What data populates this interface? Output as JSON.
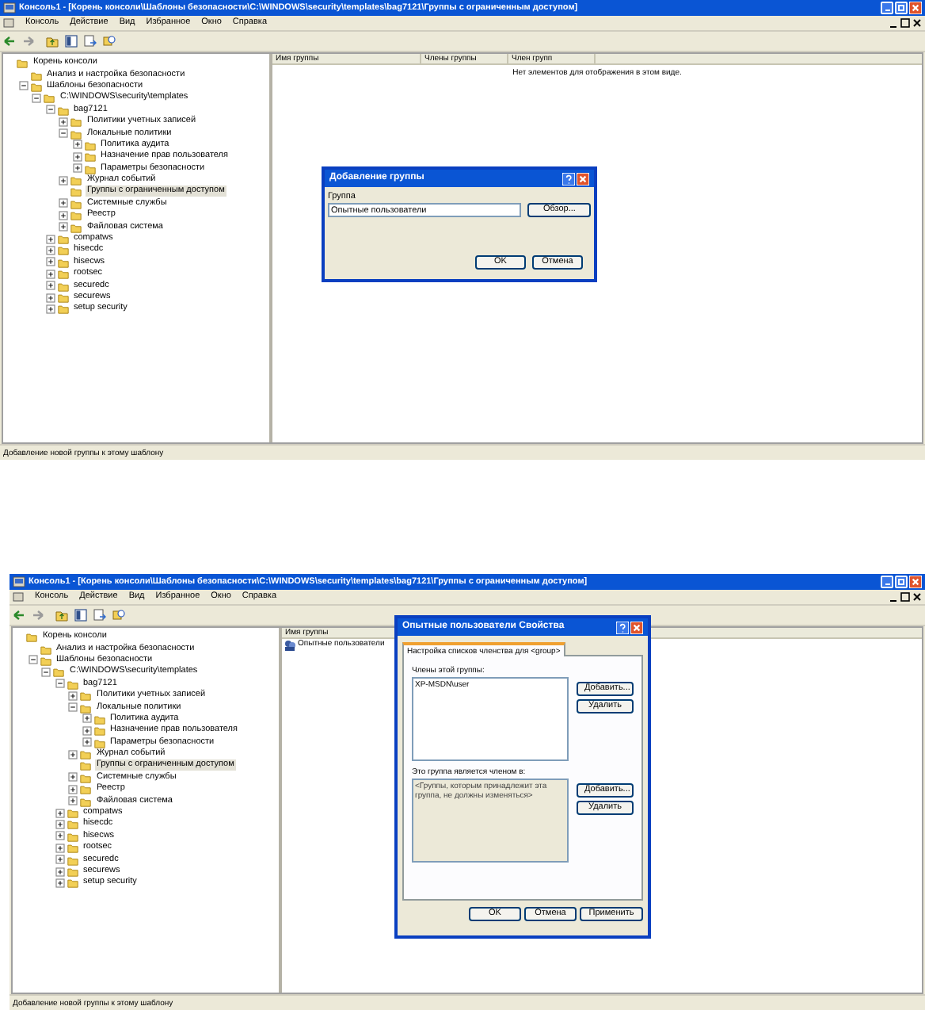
{
  "screenshots": [
    {
      "window": {
        "title": "Консоль1 - [Корень консоли\\Шаблоны безопасности\\C:\\WINDOWS\\security\\templates\\bag7121\\Группы с ограниченным доступом]"
      },
      "menu": [
        "Консоль",
        "Действие",
        "Вид",
        "Избранное",
        "Окно",
        "Справка"
      ],
      "tree": [
        {
          "label": "Корень консоли",
          "kind": "plain",
          "selected": false,
          "children": [
            {
              "label": "Анализ и настройка безопасности",
              "kind": "plain",
              "selected": false
            },
            {
              "label": "Шаблоны безопасности",
              "kind": "expandable",
              "expanded": true,
              "selected": false,
              "children": [
                {
                  "label": "C:\\WINDOWS\\security\\templates",
                  "kind": "expandable",
                  "expanded": true,
                  "selected": false,
                  "children": [
                    {
                      "label": "bag7121",
                      "kind": "expandable",
                      "expanded": true,
                      "selected": false,
                      "children": [
                        {
                          "label": "Политики учетных записей",
                          "kind": "expandable",
                          "expanded": false,
                          "selected": false
                        },
                        {
                          "label": "Локальные политики",
                          "kind": "expandable",
                          "expanded": true,
                          "selected": false,
                          "children": [
                            {
                              "label": "Политика аудита",
                              "kind": "expandable",
                              "expanded": false,
                              "selected": false
                            },
                            {
                              "label": "Назначение прав пользователя",
                              "kind": "expandable",
                              "expanded": false,
                              "selected": false
                            },
                            {
                              "label": "Параметры безопасности",
                              "kind": "expandable",
                              "expanded": false,
                              "selected": false
                            }
                          ]
                        },
                        {
                          "label": "Журнал событий",
                          "kind": "expandable",
                          "expanded": false,
                          "selected": false
                        },
                        {
                          "label": "Группы с ограниченным доступом",
                          "kind": "plain",
                          "selected": true
                        },
                        {
                          "label": "Системные службы",
                          "kind": "expandable",
                          "expanded": false,
                          "selected": false
                        },
                        {
                          "label": "Реестр",
                          "kind": "expandable",
                          "expanded": false,
                          "selected": false
                        },
                        {
                          "label": "Файловая система",
                          "kind": "expandable",
                          "expanded": false,
                          "selected": false
                        }
                      ]
                    },
                    {
                      "label": "compatws",
                      "kind": "expandable",
                      "expanded": false,
                      "selected": false
                    },
                    {
                      "label": "hisecdc",
                      "kind": "expandable",
                      "expanded": false,
                      "selected": false
                    },
                    {
                      "label": "hisecws",
                      "kind": "expandable",
                      "expanded": false,
                      "selected": false
                    },
                    {
                      "label": "rootsec",
                      "kind": "expandable",
                      "expanded": false,
                      "selected": false
                    },
                    {
                      "label": "securedc",
                      "kind": "expandable",
                      "expanded": false,
                      "selected": false
                    },
                    {
                      "label": "securews",
                      "kind": "expandable",
                      "expanded": false,
                      "selected": false
                    },
                    {
                      "label": "setup security",
                      "kind": "expandable",
                      "expanded": false,
                      "selected": false
                    }
                  ]
                }
              ]
            }
          ]
        }
      ],
      "table": {
        "columns": [
          "Имя группы",
          "Члены группы",
          "Член групп"
        ],
        "empty_message": "Нет элементов для отображения в этом виде."
      },
      "status_bar": "Добавление новой группы к этому шаблону",
      "dialog": {
        "kind": "add_group",
        "title": "Добавление группы",
        "field_label": "Группа",
        "field_value": "Опытные пользователи",
        "browse_button": "Обзор...",
        "buttons": [
          "OK",
          "Отмена"
        ]
      }
    },
    {
      "window": {
        "title": "Консоль1 - [Корень консоли\\Шаблоны безопасности\\C:\\WINDOWS\\security\\templates\\bag7121\\Группы с ограниченным доступом]"
      },
      "menu": [
        "Консоль",
        "Действие",
        "Вид",
        "Избранное",
        "Окно",
        "Справка"
      ],
      "tree": [
        {
          "label": "Корень консоли",
          "kind": "plain",
          "selected": false,
          "children": [
            {
              "label": "Анализ и настройка безопасности",
              "kind": "plain",
              "selected": false
            },
            {
              "label": "Шаблоны безопасности",
              "kind": "expandable",
              "expanded": true,
              "selected": false,
              "children": [
                {
                  "label": "C:\\WINDOWS\\security\\templates",
                  "kind": "expandable",
                  "expanded": true,
                  "selected": false,
                  "children": [
                    {
                      "label": "bag7121",
                      "kind": "expandable",
                      "expanded": true,
                      "selected": false,
                      "children": [
                        {
                          "label": "Политики учетных записей",
                          "kind": "expandable",
                          "expanded": false,
                          "selected": false
                        },
                        {
                          "label": "Локальные политики",
                          "kind": "expandable",
                          "expanded": true,
                          "selected": false,
                          "children": [
                            {
                              "label": "Политика аудита",
                              "kind": "expandable",
                              "expanded": false,
                              "selected": false
                            },
                            {
                              "label": "Назначение прав пользователя",
                              "kind": "expandable",
                              "expanded": false,
                              "selected": false
                            },
                            {
                              "label": "Параметры безопасности",
                              "kind": "expandable",
                              "expanded": false,
                              "selected": false
                            }
                          ]
                        },
                        {
                          "label": "Журнал событий",
                          "kind": "expandable",
                          "expanded": false,
                          "selected": false
                        },
                        {
                          "label": "Группы с ограниченным доступом",
                          "kind": "plain",
                          "selected": true
                        },
                        {
                          "label": "Системные службы",
                          "kind": "expandable",
                          "expanded": false,
                          "selected": false
                        },
                        {
                          "label": "Реестр",
                          "kind": "expandable",
                          "expanded": false,
                          "selected": false
                        },
                        {
                          "label": "Файловая система",
                          "kind": "expandable",
                          "expanded": false,
                          "selected": false
                        }
                      ]
                    },
                    {
                      "label": "compatws",
                      "kind": "expandable",
                      "expanded": false,
                      "selected": false
                    },
                    {
                      "label": "hisecdc",
                      "kind": "expandable",
                      "expanded": false,
                      "selected": false
                    },
                    {
                      "label": "hisecws",
                      "kind": "expandable",
                      "expanded": false,
                      "selected": false
                    },
                    {
                      "label": "rootsec",
                      "kind": "expandable",
                      "expanded": false,
                      "selected": false
                    },
                    {
                      "label": "securedc",
                      "kind": "expandable",
                      "expanded": false,
                      "selected": false
                    },
                    {
                      "label": "securews",
                      "kind": "expandable",
                      "expanded": false,
                      "selected": false
                    },
                    {
                      "label": "setup security",
                      "kind": "expandable",
                      "expanded": false,
                      "selected": false
                    }
                  ]
                }
              ]
            }
          ]
        }
      ],
      "table": {
        "columns": [
          "Имя группы"
        ],
        "rows": [
          [
            "Опытные пользователи"
          ]
        ]
      },
      "status_bar": "Добавление новой группы к этому шаблону",
      "dialog": {
        "kind": "properties",
        "title": "Опытные пользователи Свойства",
        "tab": {
          "label": "Настройка списков членства для <group>",
          "selected": true
        },
        "sections": [
          {
            "label": "Члены этой группы:",
            "items": [
              "XP-MSDN\\user"
            ],
            "disabled": false,
            "buttons": [
              "Добавить...",
              "Удалить"
            ]
          },
          {
            "label": "Это группа является членом в:",
            "items": [
              "<Группы, которым принадлежит эта группа, не должны изменяться>"
            ],
            "disabled": true,
            "buttons": [
              "Добавить...",
              "Удалить"
            ]
          }
        ],
        "buttons": [
          "OK",
          "Отмена",
          "Применить"
        ]
      }
    }
  ]
}
